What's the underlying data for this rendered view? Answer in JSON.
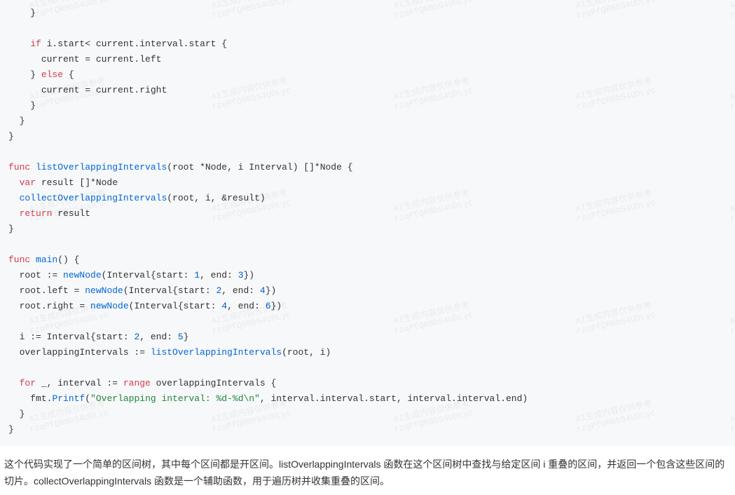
{
  "code": {
    "lines": [
      {
        "indent": 4,
        "tokens": [
          {
            "t": "}",
            "c": ""
          }
        ]
      },
      {
        "indent": 0,
        "tokens": []
      },
      {
        "indent": 4,
        "tokens": [
          {
            "t": "if",
            "c": "kw"
          },
          {
            "t": " i.start< current.interval.start {",
            "c": ""
          }
        ]
      },
      {
        "indent": 6,
        "tokens": [
          {
            "t": "current = current.left",
            "c": ""
          }
        ]
      },
      {
        "indent": 4,
        "tokens": [
          {
            "t": "} ",
            "c": ""
          },
          {
            "t": "else",
            "c": "kw"
          },
          {
            "t": " {",
            "c": ""
          }
        ]
      },
      {
        "indent": 6,
        "tokens": [
          {
            "t": "current = current.right",
            "c": ""
          }
        ]
      },
      {
        "indent": 4,
        "tokens": [
          {
            "t": "}",
            "c": ""
          }
        ]
      },
      {
        "indent": 2,
        "tokens": [
          {
            "t": "}",
            "c": ""
          }
        ]
      },
      {
        "indent": 0,
        "tokens": [
          {
            "t": "}",
            "c": ""
          }
        ]
      },
      {
        "indent": 0,
        "tokens": []
      },
      {
        "indent": 0,
        "tokens": [
          {
            "t": "func",
            "c": "kw"
          },
          {
            "t": " ",
            "c": ""
          },
          {
            "t": "listOverlappingIntervals",
            "c": "fn"
          },
          {
            "t": "(root *Node, i Interval) []*Node {",
            "c": ""
          }
        ]
      },
      {
        "indent": 2,
        "tokens": [
          {
            "t": "var",
            "c": "kw"
          },
          {
            "t": " result []*Node",
            "c": ""
          }
        ]
      },
      {
        "indent": 2,
        "tokens": [
          {
            "t": "collectOverlappingIntervals",
            "c": "fn"
          },
          {
            "t": "(root, i, &result)",
            "c": ""
          }
        ]
      },
      {
        "indent": 2,
        "tokens": [
          {
            "t": "return",
            "c": "kw"
          },
          {
            "t": " result",
            "c": ""
          }
        ]
      },
      {
        "indent": 0,
        "tokens": [
          {
            "t": "}",
            "c": ""
          }
        ]
      },
      {
        "indent": 0,
        "tokens": []
      },
      {
        "indent": 0,
        "tokens": [
          {
            "t": "func",
            "c": "kw"
          },
          {
            "t": " ",
            "c": ""
          },
          {
            "t": "main",
            "c": "fn"
          },
          {
            "t": "() {",
            "c": ""
          }
        ]
      },
      {
        "indent": 2,
        "tokens": [
          {
            "t": "root := ",
            "c": ""
          },
          {
            "t": "newNode",
            "c": "fn"
          },
          {
            "t": "(Interval{start: ",
            "c": ""
          },
          {
            "t": "1",
            "c": "num"
          },
          {
            "t": ", end: ",
            "c": ""
          },
          {
            "t": "3",
            "c": "num"
          },
          {
            "t": "})",
            "c": ""
          }
        ]
      },
      {
        "indent": 2,
        "tokens": [
          {
            "t": "root.left = ",
            "c": ""
          },
          {
            "t": "newNode",
            "c": "fn"
          },
          {
            "t": "(Interval{start: ",
            "c": ""
          },
          {
            "t": "2",
            "c": "num"
          },
          {
            "t": ", end: ",
            "c": ""
          },
          {
            "t": "4",
            "c": "num"
          },
          {
            "t": "})",
            "c": ""
          }
        ]
      },
      {
        "indent": 2,
        "tokens": [
          {
            "t": "root.right = ",
            "c": ""
          },
          {
            "t": "newNode",
            "c": "fn"
          },
          {
            "t": "(Interval{start: ",
            "c": ""
          },
          {
            "t": "4",
            "c": "num"
          },
          {
            "t": ", end: ",
            "c": ""
          },
          {
            "t": "6",
            "c": "num"
          },
          {
            "t": "})",
            "c": ""
          }
        ]
      },
      {
        "indent": 0,
        "tokens": []
      },
      {
        "indent": 2,
        "tokens": [
          {
            "t": "i := Interval{start: ",
            "c": ""
          },
          {
            "t": "2",
            "c": "num"
          },
          {
            "t": ", end: ",
            "c": ""
          },
          {
            "t": "5",
            "c": "num"
          },
          {
            "t": "}",
            "c": ""
          }
        ]
      },
      {
        "indent": 2,
        "tokens": [
          {
            "t": "overlappingIntervals := ",
            "c": ""
          },
          {
            "t": "listOverlappingIntervals",
            "c": "fn"
          },
          {
            "t": "(root, i)",
            "c": ""
          }
        ]
      },
      {
        "indent": 0,
        "tokens": []
      },
      {
        "indent": 2,
        "tokens": [
          {
            "t": "for",
            "c": "kw"
          },
          {
            "t": " _, interval := ",
            "c": ""
          },
          {
            "t": "range",
            "c": "kw"
          },
          {
            "t": " overlappingIntervals {",
            "c": ""
          }
        ]
      },
      {
        "indent": 4,
        "tokens": [
          {
            "t": "fmt.",
            "c": ""
          },
          {
            "t": "Printf",
            "c": "fn"
          },
          {
            "t": "(",
            "c": ""
          },
          {
            "t": "\"Overlapping interval: %d-%d\\n\"",
            "c": "str"
          },
          {
            "t": ", interval.interval.start, interval.interval.end)",
            "c": ""
          }
        ]
      },
      {
        "indent": 2,
        "tokens": [
          {
            "t": "}",
            "c": ""
          }
        ]
      },
      {
        "indent": 0,
        "tokens": [
          {
            "t": "}",
            "c": ""
          }
        ]
      }
    ]
  },
  "prose": {
    "text": "这个代码实现了一个简单的区间树，其中每个区间都是开区间。listOverlappingIntervals 函数在这个区间树中查找与给定区间 i 重叠的区间，并返回一个包含这些区间的切片。collectOverlappingIntervals 函数是一个辅助函数，用于遍历树并收集重叠的区间。"
  },
  "watermark": {
    "line1": "AI生成内容仅供参考",
    "line2": "rzqPfQRBbS4UDLyc"
  }
}
